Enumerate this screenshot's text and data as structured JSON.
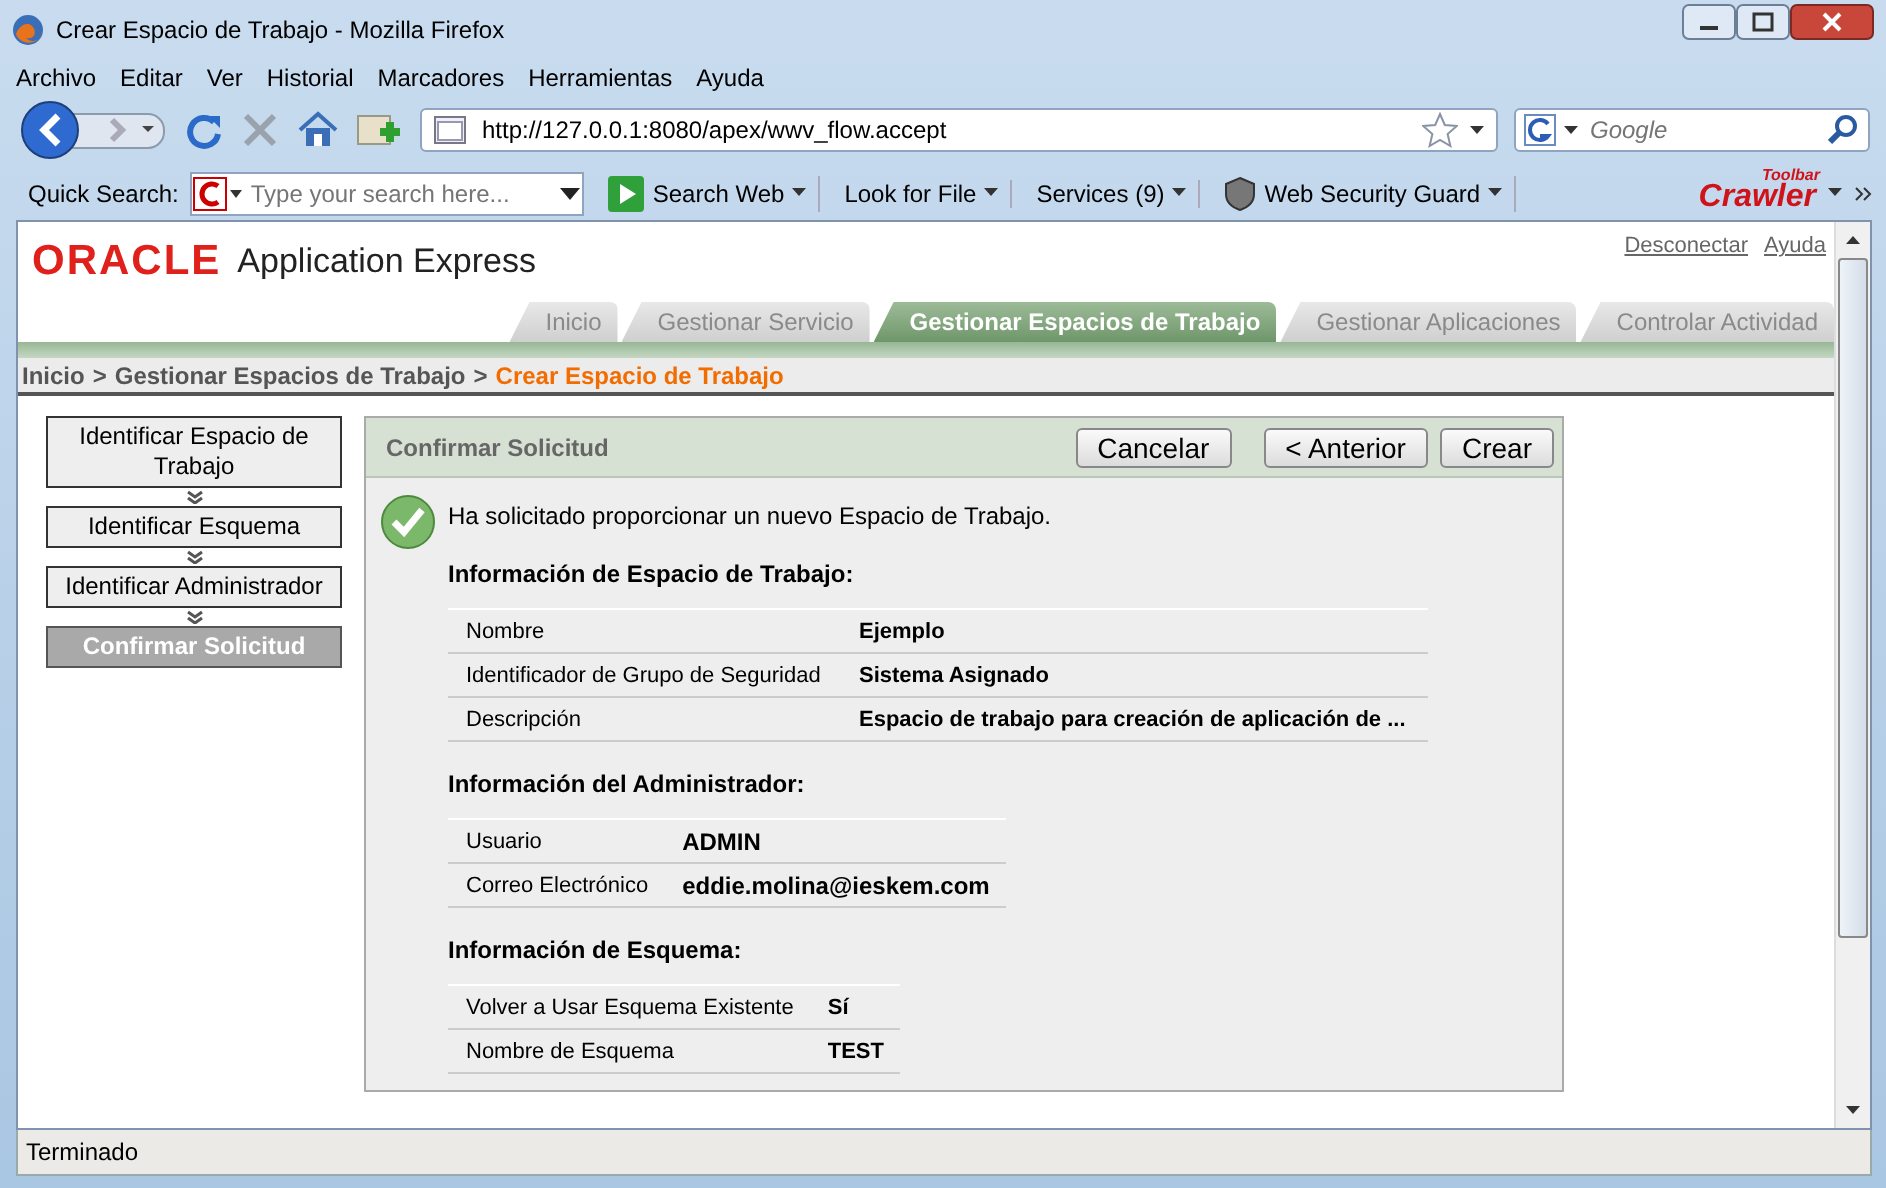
{
  "window": {
    "title": "Crear Espacio de Trabajo - Mozilla Firefox"
  },
  "menu": [
    "Archivo",
    "Editar",
    "Ver",
    "Historial",
    "Marcadores",
    "Herramientas",
    "Ayuda"
  ],
  "address": {
    "value": "http://127.0.0.1:8080/apex/wwv_flow.accept"
  },
  "search": {
    "placeholder": "Google"
  },
  "toolbar": {
    "label": "Quick Search:",
    "search": {
      "placeholder": "Type your search here..."
    },
    "buttons": [
      {
        "kind": "play",
        "label": "Search Web"
      },
      {
        "kind": "plain",
        "label": "Look for File"
      },
      {
        "kind": "plain",
        "label": "Services (9)"
      },
      {
        "kind": "shield",
        "label": "Web Security Guard"
      }
    ],
    "logo": {
      "text": "Crawler",
      "badge": "Toolbar"
    }
  },
  "app": {
    "logo": "ORACLE",
    "title": "Application Express",
    "links": [
      "Desconectar",
      "Ayuda"
    ],
    "tabs": [
      {
        "label": "Inicio",
        "selected": false
      },
      {
        "label": "Gestionar Servicio",
        "selected": false
      },
      {
        "label": "Gestionar Espacios de Trabajo",
        "selected": true
      },
      {
        "label": "Gestionar Aplicaciones",
        "selected": false
      },
      {
        "label": "Controlar Actividad",
        "selected": false
      }
    ],
    "breadcrumb": {
      "separator": ">",
      "items": [
        {
          "label": "Inicio",
          "current": false
        },
        {
          "label": "Gestionar Espacios de Trabajo",
          "current": false
        },
        {
          "label": "Crear Espacio de Trabajo",
          "current": true
        }
      ]
    },
    "steps": [
      {
        "label": "Identificar Espacio de Trabajo",
        "selected": false
      },
      {
        "label": "Identificar Esquema",
        "selected": false
      },
      {
        "label": "Identificar Administrador",
        "selected": false
      },
      {
        "label": "Confirmar Solicitud",
        "selected": true
      }
    ],
    "region": {
      "title": "Confirmar Solicitud",
      "buttons": [
        "Cancelar",
        "< Anterior",
        "Crear"
      ],
      "message": "Ha solicitado proporcionar un nuevo Espacio de Trabajo.",
      "sections": [
        {
          "heading": "Información de Espacio de Trabajo:",
          "rows": [
            {
              "label": "Nombre",
              "value": "Ejemplo"
            },
            {
              "label": "Identificador de Grupo de Seguridad",
              "value": "Sistema Asignado"
            },
            {
              "label": "Descripción",
              "value": "Espacio de trabajo para creación de aplicación de ..."
            }
          ]
        },
        {
          "heading": "Información del Administrador:",
          "rows": [
            {
              "label": "Usuario",
              "value": "ADMIN"
            },
            {
              "label": "Correo Electrónico",
              "value": "eddie.molina@ieskem.com"
            }
          ]
        },
        {
          "heading": "Información de Esquema:",
          "rows": [
            {
              "label": "Volver a Usar Esquema Existente",
              "value": "Sí"
            },
            {
              "label": "Nombre de Esquema",
              "value": "TEST"
            }
          ]
        }
      ]
    }
  },
  "status_bar": "Terminado"
}
